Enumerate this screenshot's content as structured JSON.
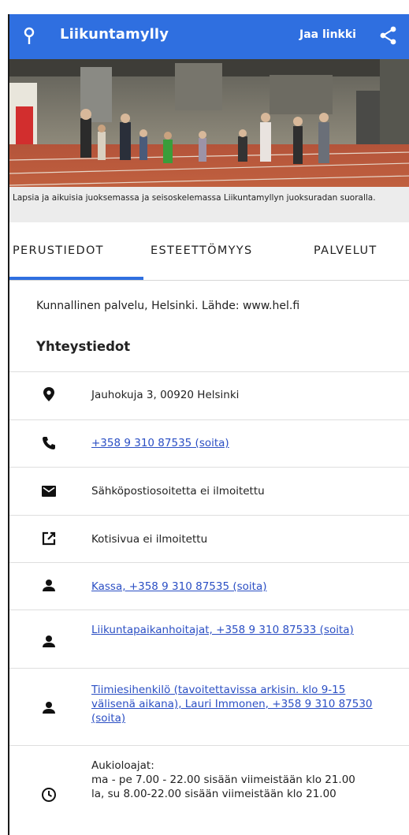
{
  "header": {
    "title": "Liikuntamylly",
    "share_label": "Jaa linkki",
    "brand_color": "#2f6fe0"
  },
  "hero": {
    "caption": "Lapsia ja aikuisia juoksemassa ja seisoskelemassa Liikuntamyllyn juoksuradan suoralla."
  },
  "tabs": [
    {
      "label": "PERUSTIEDOT",
      "active": true
    },
    {
      "label": "ESTEETTÖMYYS",
      "active": false
    },
    {
      "label": "PALVELUT",
      "active": false
    }
  ],
  "main": {
    "source_text": "Kunnallinen palvelu, Helsinki. Lähde: www.hel.fi",
    "section_title": "Yhteystiedot"
  },
  "contacts": [
    {
      "icon": "location-pin-icon",
      "text": "Jauhokuja 3, 00920 Helsinki",
      "link": false
    },
    {
      "icon": "phone-icon",
      "text": "+358 9 310 87535 (soita)",
      "link": true
    },
    {
      "icon": "mail-icon",
      "text": "Sähköpostiosoitetta ei ilmoitettu",
      "link": false
    },
    {
      "icon": "external-link-icon",
      "text": "Kotisivua ei ilmoitettu",
      "link": false
    },
    {
      "icon": "person-icon",
      "text": "Kassa, +358 9 310 87535 (soita)",
      "link": true
    },
    {
      "icon": "person-icon",
      "text": "Liikuntapaikanhoitajat, +358 9 310 87533 (soita)",
      "link": true
    },
    {
      "icon": "person-icon",
      "text": "Tiimiesihenkilö (tavoitettavissa arkisin. klo 9-15 välisenä aikana), Lauri Immonen, +358 9 310 87530 (soita)",
      "link": true
    },
    {
      "icon": "clock-icon",
      "lines": [
        "Aukioloajat:",
        "ma - pe 7.00 - 22.00 sisään viimeistään klo 21.00",
        "la, su 8.00-22.00 sisään viimeistään klo 21.00"
      ],
      "link": false
    }
  ]
}
